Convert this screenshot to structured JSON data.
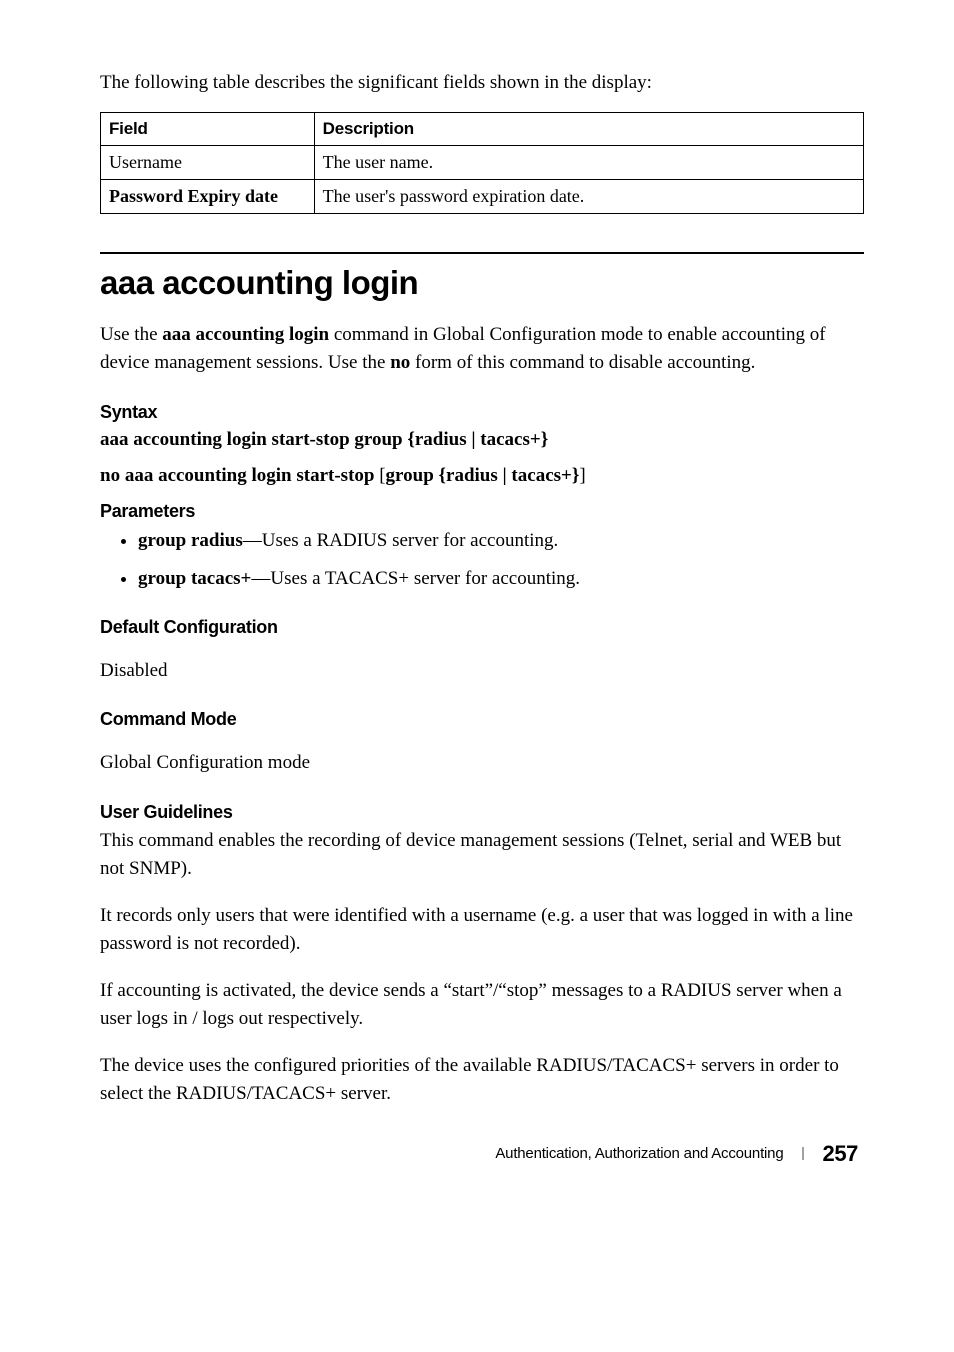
{
  "intro_text": "The following table describes the significant fields shown in the display:",
  "table": {
    "headers": {
      "field": "Field",
      "description": "Description"
    },
    "rows": [
      {
        "field": "Username",
        "description": "The user name.",
        "bold": false
      },
      {
        "field": "Password Expiry date",
        "description": "The user's password expiration date.",
        "bold": true
      }
    ]
  },
  "command": {
    "heading": "aaa accounting login",
    "desc_pre": "Use the ",
    "desc_b1": "aaa accounting login",
    "desc_mid": " command in Global Configuration mode to enable accounting of device management sessions. Use the ",
    "desc_b2": "no",
    "desc_post": " form of this command to disable accounting."
  },
  "syntax": {
    "heading": "Syntax",
    "line1": "aaa accounting login start-stop group {radius | tacacs+}",
    "line2_p1": "no aaa accounting login start-stop ",
    "line2_open": "[",
    "line2_p2": "group {radius | tacacs+}",
    "line2_close": "]"
  },
  "parameters": {
    "heading": "Parameters",
    "items": [
      {
        "bold": "group radius",
        "rest": "—Uses a RADIUS server for accounting."
      },
      {
        "bold": "group tacacs+",
        "rest": "—Uses a TACACS+ server for accounting."
      }
    ]
  },
  "default_config": {
    "heading": "Default Configuration",
    "text": "Disabled"
  },
  "command_mode": {
    "heading": "Command Mode",
    "text": "Global Configuration mode"
  },
  "user_guidelines": {
    "heading": "User Guidelines",
    "paras": [
      "This command enables the recording of device management sessions (Telnet, serial and WEB but not SNMP).",
      "It records only users that were identified with a username (e.g. a user that was logged in with a line password is not recorded).",
      "If accounting is activated, the device sends a “start”/“stop” messages to a RADIUS server when a user logs in / logs out respectively.",
      "The device uses the configured priorities of the available RADIUS/TACACS+ servers in order to select the RADIUS/TACACS+ server."
    ]
  },
  "footer": {
    "title": "Authentication, Authorization and Accounting",
    "page": "257"
  }
}
